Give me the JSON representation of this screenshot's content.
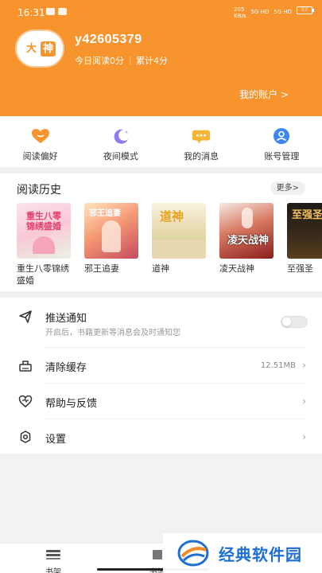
{
  "status_bar": {
    "time": "16:31",
    "network_speed": "205\nKB/s",
    "signal1": "5G HD",
    "signal2": "5G HD",
    "battery": "57"
  },
  "profile": {
    "avatar_chars": [
      "大",
      "神"
    ],
    "username": "y42605379",
    "today_read": "今日阅读0分",
    "total": "累计4分",
    "account_link": "我的账户 >"
  },
  "quick_actions": [
    {
      "label": "阅读偏好",
      "icon": "heart-icon"
    },
    {
      "label": "夜间模式",
      "icon": "moon-icon"
    },
    {
      "label": "我的消息",
      "icon": "message-icon"
    },
    {
      "label": "账号管理",
      "icon": "user-icon"
    }
  ],
  "history": {
    "title": "阅读历史",
    "more_label": "更多>",
    "books": [
      {
        "title": "重生八零锦绣盛婚",
        "cover_text": "重生八零\n锦绣盛婚"
      },
      {
        "title": "邪王追妻",
        "cover_text": "邪王追妻"
      },
      {
        "title": "道神",
        "cover_text": "道神"
      },
      {
        "title": "凌天战神",
        "cover_text": "凌天战神"
      },
      {
        "title": "至强圣",
        "cover_text": "至强圣体"
      }
    ]
  },
  "settings": {
    "push": {
      "label": "推送通知",
      "sub": "开启后，书籍更新等消息会及时通知您",
      "enabled": false
    },
    "cache": {
      "label": "清除缓存",
      "value": "12.51MB"
    },
    "help": {
      "label": "帮助与反馈"
    },
    "setup": {
      "label": "设置"
    }
  },
  "tabbar": {
    "tabs": [
      {
        "label": "书架"
      },
      {
        "label": "书城"
      }
    ]
  },
  "watermark": {
    "text": "经典软件园"
  },
  "colors": {
    "accent": "#f7942d",
    "brand_blue": "#1d6fd1"
  }
}
